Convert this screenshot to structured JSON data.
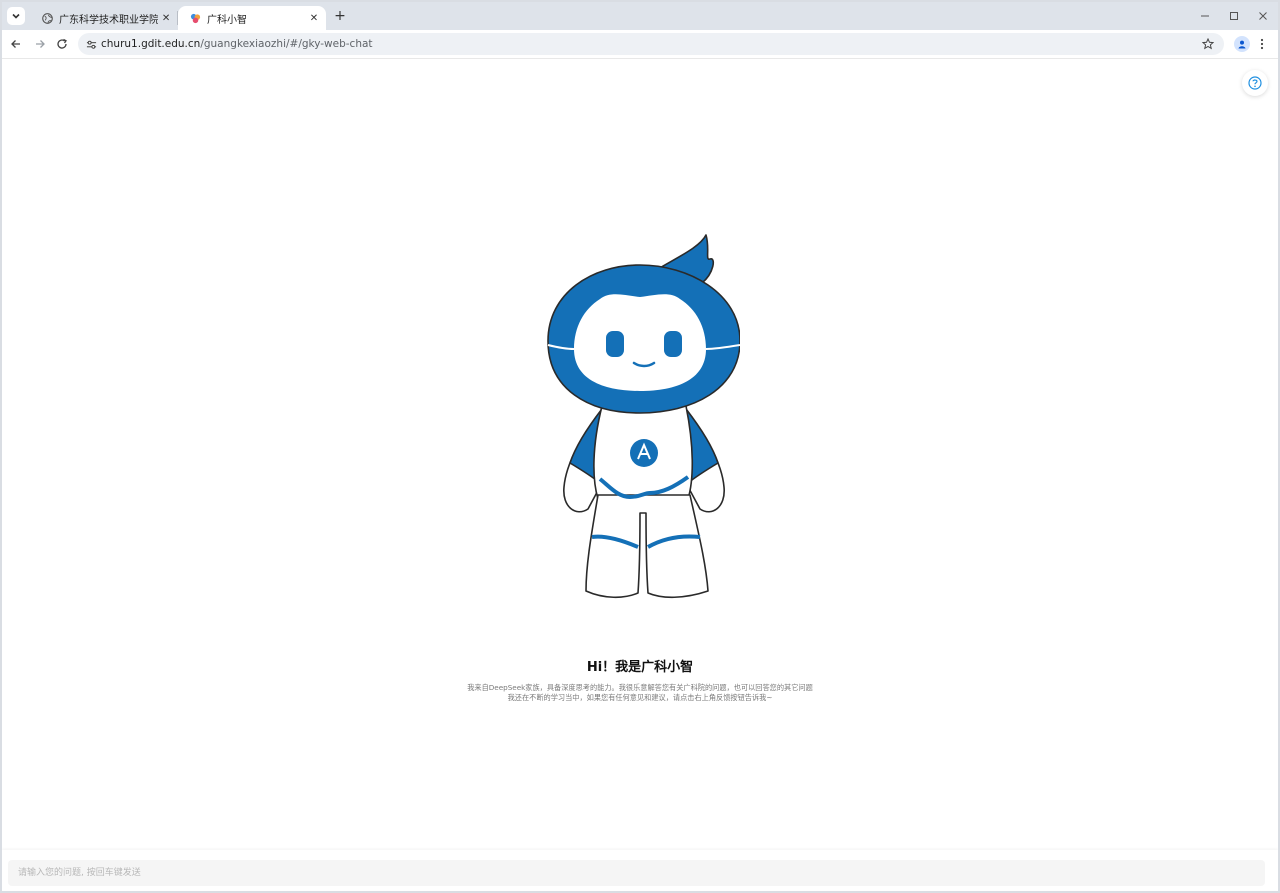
{
  "browser": {
    "tabs": [
      {
        "title": "广东科学技术职业学院",
        "active": false,
        "favicon": "globe-icon"
      },
      {
        "title": "广科小智",
        "active": true,
        "favicon": "app-logo-icon"
      }
    ],
    "close_label": "✕",
    "new_tab_label": "+",
    "url_host": "churu1.gdit.edu.cn",
    "url_path": "/guangkexiaozhi/#/gky-web-chat"
  },
  "chat": {
    "greeting": "Hi！我是广科小智",
    "intro_line1": "我来自DeepSeek家族，具备深度思考的能力。我很乐意解答您有关广科院的问题，也可以回答您的其它问题",
    "intro_line2": "我还在不断的学习当中，如果您有任何意见和建议，请点击右上角反馈按钮告诉我~",
    "input_placeholder": "请输入您的问题, 按回车键发送",
    "input_value": ""
  },
  "colors": {
    "brand_blue": "#1470b7",
    "tabstrip_bg": "#dee3ea",
    "help_icon": "#1f8fe0"
  }
}
